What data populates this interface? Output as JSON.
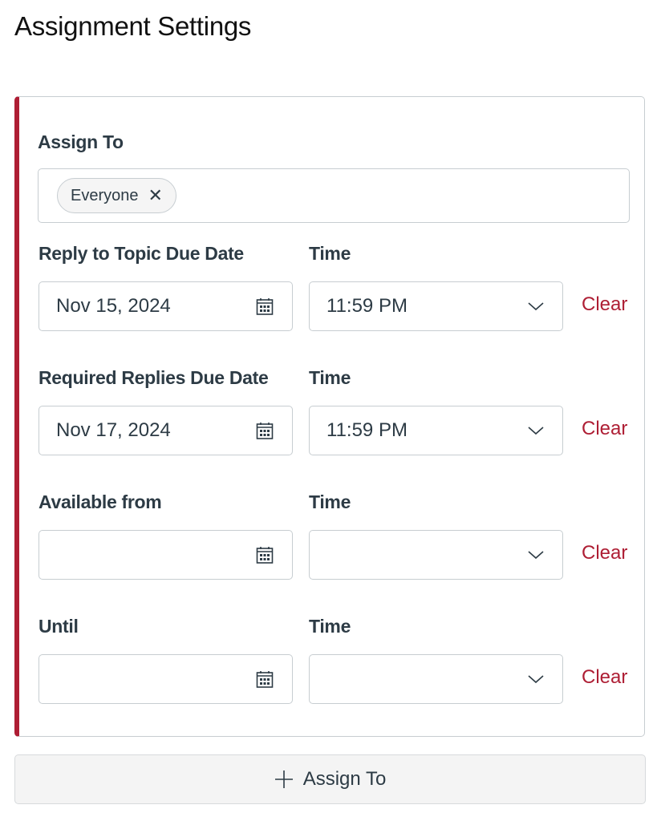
{
  "page": {
    "title": "Assignment Settings"
  },
  "colors": {
    "accent": "#ae1e34",
    "text": "#2d3b45",
    "border": "#c7cdd1"
  },
  "assign": {
    "label": "Assign To",
    "chips": [
      {
        "label": "Everyone",
        "remove_icon": "close-icon"
      }
    ]
  },
  "rows": [
    {
      "date_label": "Reply to Topic Due Date",
      "time_label": "Time",
      "date_value": "Nov 15, 2024",
      "time_value": "11:59 PM",
      "clear_label": "Clear"
    },
    {
      "date_label": "Required Replies Due Date",
      "time_label": "Time",
      "date_value": "Nov 17, 2024",
      "time_value": "11:59 PM",
      "clear_label": "Clear"
    },
    {
      "date_label": "Available from",
      "time_label": "Time",
      "date_value": "",
      "time_value": "",
      "clear_label": "Clear"
    },
    {
      "date_label": "Until",
      "time_label": "Time",
      "date_value": "",
      "time_value": "",
      "clear_label": "Clear"
    }
  ],
  "icons": {
    "date": "calendar-icon",
    "time": "chevron-down-icon",
    "add": "plus-icon"
  },
  "add_button": {
    "label": "Assign To"
  }
}
